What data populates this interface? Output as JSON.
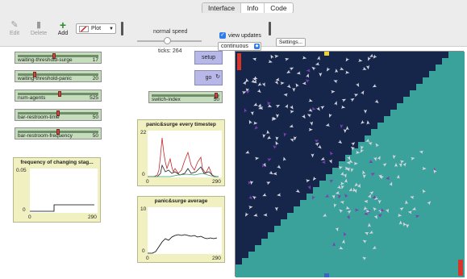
{
  "tabs": [
    "Interface",
    "Info",
    "Code"
  ],
  "toolbar": {
    "edit_label": "Edit",
    "delete_label": "Delete",
    "add_label": "Add",
    "widget_selected": "Plot",
    "speed_label": "normal speed",
    "ticks_text": "ticks: 264",
    "view_updates_label": "view updates",
    "view_updates_checked": true,
    "update_mode": "continuous",
    "settings_label": "Settings..."
  },
  "sliders": [
    {
      "label": "waiting-threshold-surge",
      "value": "17",
      "fraction": 0.45
    },
    {
      "label": "waiting-threshold-panic",
      "value": "20",
      "fraction": 0.2
    },
    {
      "label": "num-agents",
      "value": "525",
      "fraction": 0.52
    },
    {
      "label": "bar-restroom-time",
      "value": "50",
      "fraction": 0.5
    },
    {
      "label": "bar-restroom-frequency",
      "value": "50",
      "fraction": 0.5
    },
    {
      "label": "switch-index",
      "value": "50",
      "fraction": 0.97
    }
  ],
  "buttons": {
    "setup": "setup",
    "go": "go"
  },
  "plots": {
    "frequency": {
      "title": "frequency of changing stag...",
      "ymax": "0.05",
      "ymin": "0",
      "xmin": "0",
      "xmax": "290"
    },
    "panic_surge": {
      "title": "panic&surge every timestep",
      "ymax": "22",
      "ymin": "0",
      "xmin": "0",
      "xmax": "290"
    },
    "panic_avg": {
      "title": "panic&surge average",
      "ymax": "10",
      "ymin": "0",
      "xmin": "0",
      "xmax": "290"
    }
  },
  "colors": {
    "dark": "#15264a",
    "teal": "#3aa29b",
    "agent": "#d6d6e0",
    "agent_alt": "#7a3fb0",
    "slider_bg": "#c5dcbd",
    "button_bg": "#b8b8e8",
    "plot_bg": "#f0f0c0"
  }
}
